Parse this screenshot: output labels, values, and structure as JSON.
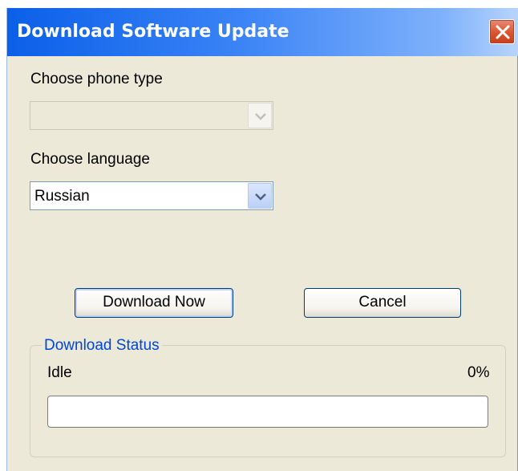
{
  "window": {
    "title": "Download Software Update"
  },
  "phone_type": {
    "label": "Choose phone type",
    "value": "",
    "enabled": false
  },
  "language": {
    "label": "Choose language",
    "value": "Russian"
  },
  "buttons": {
    "download": "Download Now",
    "cancel": "Cancel"
  },
  "status": {
    "group_title": "Download Status",
    "state": "Idle",
    "percent": "0%",
    "progress_fraction": 0
  },
  "icons": {
    "close": "close-icon",
    "dropdown": "chevron-down-icon"
  },
  "colors": {
    "titlebar": "#0b5fe8",
    "close_button": "#d9542f",
    "group_title": "#0046d5",
    "window_bg": "#ece9d8"
  }
}
